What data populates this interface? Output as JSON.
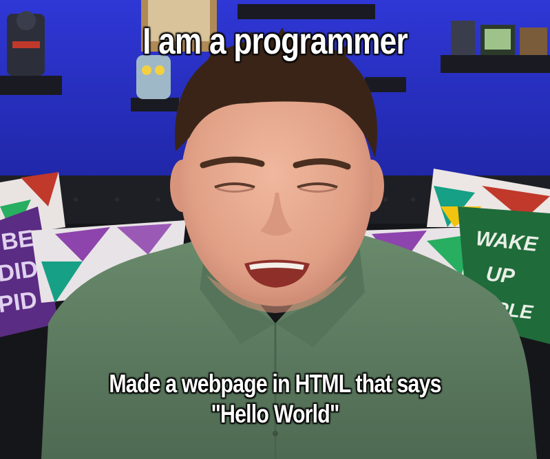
{
  "meme": {
    "top_caption": "I am a programmer",
    "bottom_caption_line1": "Made a webpage in HTML that says",
    "bottom_caption_line2": "\"Hello World\"",
    "pillow_text_left": "BE\nDID\nPID",
    "pillow_text_right": "WAKE\nUP\nPEOPLE"
  },
  "colors": {
    "wall": "#2a33c9",
    "couch": "#15161a",
    "shirt": "#5d7a60",
    "skin": "#e7ad92",
    "hair": "#3a2418",
    "caption_text": "#ffffff"
  }
}
